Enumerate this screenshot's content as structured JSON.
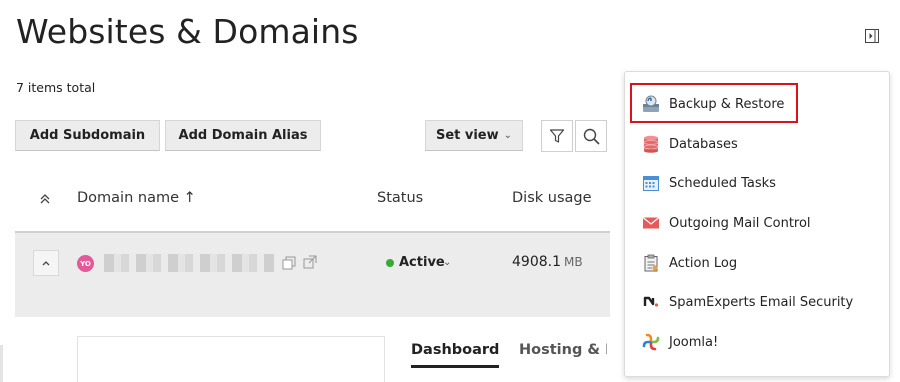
{
  "page": {
    "title": "Websites & Domains",
    "items_total": "7 items total"
  },
  "toolbar": {
    "add_subdomain": "Add Subdomain",
    "add_domain_alias": "Add Domain Alias",
    "set_view": "Set view",
    "set_view_caret": "⌄",
    "filter_icon": "filter-icon",
    "search_icon": "search-icon"
  },
  "table": {
    "columns": [
      "Domain name ↑",
      "Status",
      "Disk usage"
    ],
    "rows": [
      {
        "icon_text": "YO",
        "icon_color": "#e25a9a",
        "status": "Active",
        "status_color": "#3aa935",
        "disk_value": "4908.1",
        "disk_unit": "MB"
      }
    ]
  },
  "detail": {
    "tabs": [
      "Dashboard",
      "Hosting & D"
    ]
  },
  "dropdown_menu": {
    "highlight_color": "#d9121c",
    "items": [
      {
        "label": "Backup & Restore",
        "icon": "backup-icon"
      },
      {
        "label": "Databases",
        "icon": "database-icon"
      },
      {
        "label": "Scheduled Tasks",
        "icon": "calendar-icon"
      },
      {
        "label": "Outgoing Mail Control",
        "icon": "mail-icon"
      },
      {
        "label": "Action Log",
        "icon": "clipboard-icon"
      },
      {
        "label": "SpamExperts Email Security",
        "icon": "spamexperts-icon"
      },
      {
        "label": "Joomla!",
        "icon": "joomla-icon"
      }
    ]
  }
}
